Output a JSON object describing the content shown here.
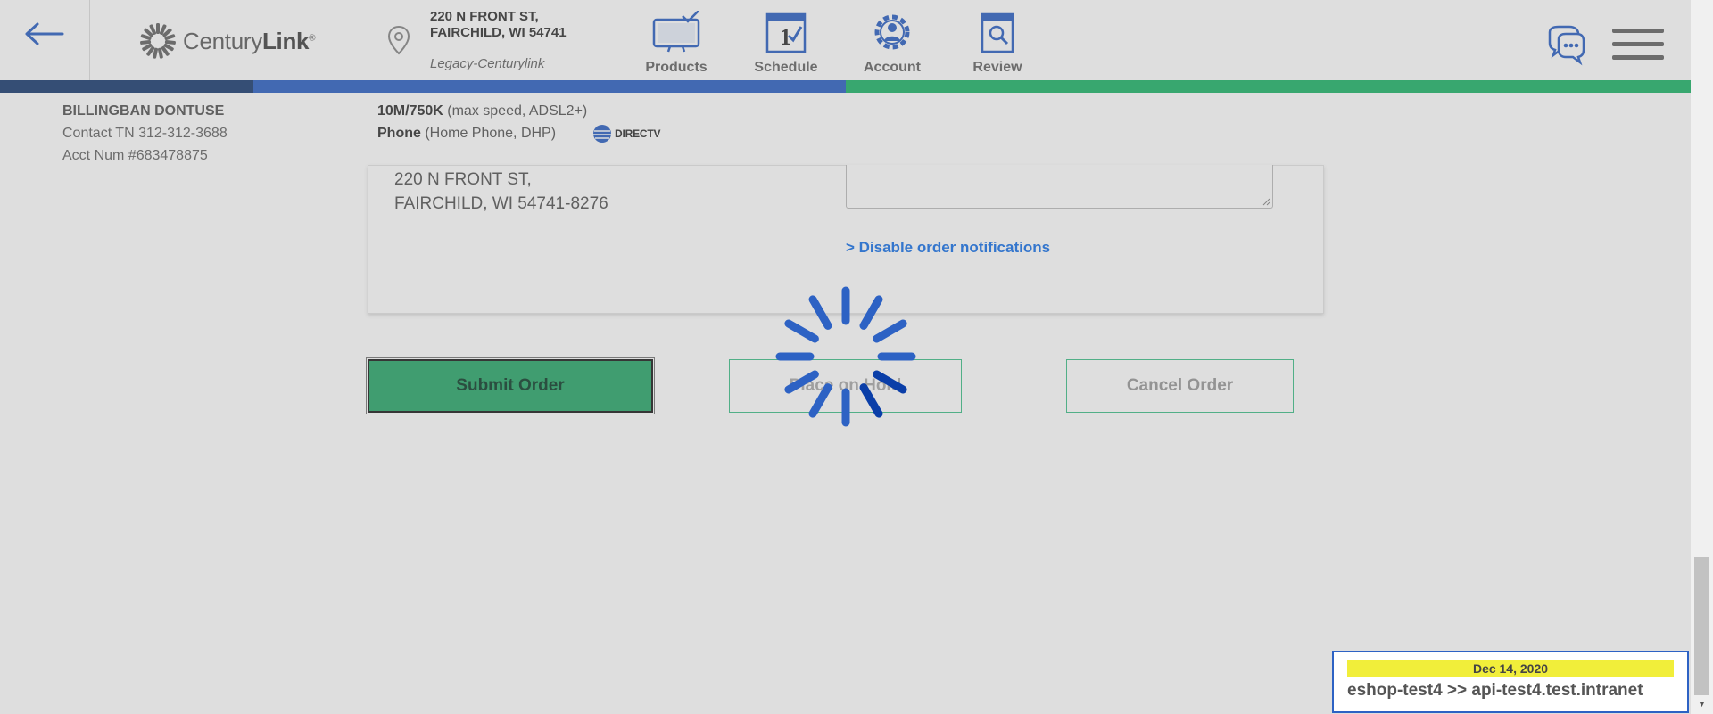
{
  "header": {
    "address_line1": "220 N FRONT ST,",
    "address_line2": "FAIRCHILD, WI 54741",
    "legacy_label": "Legacy-Centurylink",
    "logo": {
      "prefix": "Century",
      "suffix": "Link"
    },
    "nav": [
      {
        "label": "Products",
        "icon": "tv-icon"
      },
      {
        "label": "Schedule",
        "icon": "calendar-icon"
      },
      {
        "label": "Account",
        "icon": "gear-user-icon"
      },
      {
        "label": "Review",
        "icon": "review-icon"
      }
    ]
  },
  "progress_colors": {
    "done": "#1c3d72",
    "current": "#2d62c4",
    "next": "#20b56a"
  },
  "customer": {
    "name": "BILLINGBAN DONTUSE",
    "contact": "Contact TN 312-312-3688",
    "acct": "Acct Num #683478875"
  },
  "services": {
    "internet_bold": "10M/750K",
    "internet_detail": " (max speed, ADSL2+)",
    "phone_bold": "Phone",
    "phone_detail": " (Home Phone, DHP)",
    "partner_label": "DIRECTV"
  },
  "card": {
    "address_line1": "220 N FRONT ST,",
    "address_line2": "FAIRCHILD, WI 54741-8276",
    "disable_link": "> Disable order notifications"
  },
  "buttons": {
    "submit": "Submit Order",
    "hold": "Place on Hold",
    "cancel": "Cancel Order"
  },
  "env": {
    "date": "Dec 14, 2020",
    "text": "eshop-test4 >> api-test4.test.intranet"
  },
  "loading": true
}
